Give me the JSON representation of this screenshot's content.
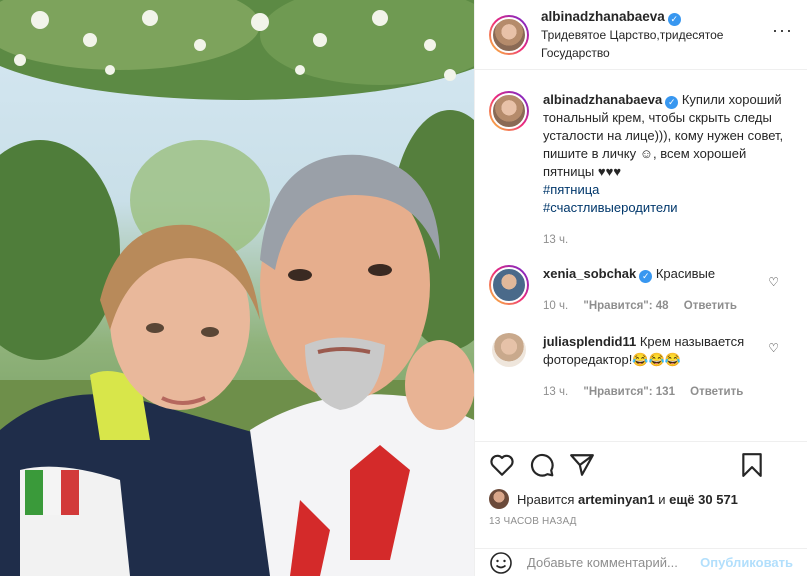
{
  "post": {
    "author": "albinadzhanabaeva",
    "location": "Тридевятое Царство,тридесятое Государство",
    "more_icon": "more-horizontal-icon"
  },
  "caption": {
    "author": "albinadzhanabaeva",
    "text": "Купили хороший тональный крем, чтобы скрыть следы усталости на лице))), кому нужен совет, пишите в личку ☺, всем хорошей пятницы ♥♥♥",
    "hashtags": [
      "#пятница",
      "#счастливыеродители"
    ],
    "time": "13 ч."
  },
  "comments": [
    {
      "author": "xenia_sobchak",
      "verified": true,
      "text": "Красивые",
      "time": "10 ч.",
      "likes": "\"Нравится\": 48",
      "reply": "Ответить"
    },
    {
      "author": "juliasplendid11",
      "verified": false,
      "text": "Крем называется фоторедактор!😂😂😂",
      "time": "13 ч.",
      "likes": "\"Нравится\": 131",
      "reply": "Ответить"
    }
  ],
  "likes_line": {
    "prefix": "Нравится",
    "user": "arteminyan1",
    "mid": "и",
    "count": "ещё 30 571"
  },
  "timestamp": "13 часов назад",
  "add_comment": {
    "placeholder": "Добавьте комментарий...",
    "publish": "Опубликовать"
  },
  "colors": {
    "accent": "#3897f0",
    "link": "#00376b",
    "muted": "#8e8e8e",
    "publish_disabled": "#b2dffc"
  }
}
